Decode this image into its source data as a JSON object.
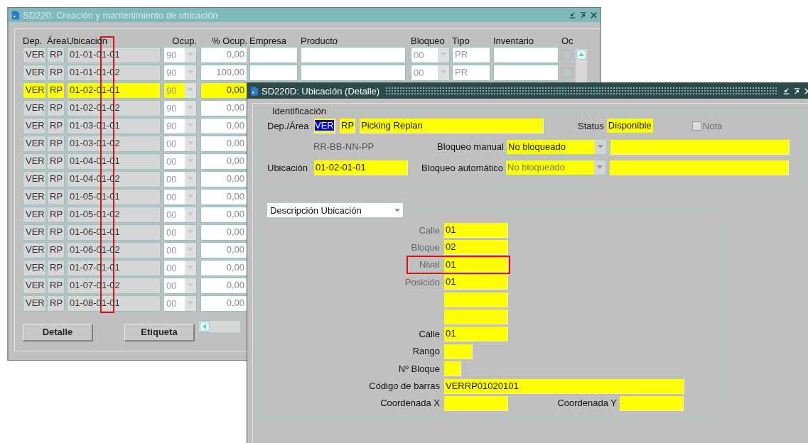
{
  "main_window": {
    "title": "SD220: Creación y mantenimiento de ubicación",
    "active": false,
    "columns": [
      "Dep.",
      "Área",
      "Ubicación",
      "Ocup.",
      "% Ocup.",
      "Empresa",
      "Producto",
      "Bloqueo",
      "Tipo",
      "Inventario",
      "Oc"
    ],
    "annotations": [
      {
        "kind": "column_frame"
      }
    ],
    "rows": [
      {
        "dep": "VER",
        "area": "RP",
        "ubicacion": "01-01-01-01",
        "ocup": "90",
        "pct_ocup": "0,00",
        "selected": false,
        "bloqueo": "00",
        "tipo": "PR",
        "oc_checked": false
      },
      {
        "dep": "VER",
        "area": "RP",
        "ubicacion": "01-01-01-02",
        "ocup": "90",
        "pct_ocup": "100,00",
        "selected": false,
        "bloqueo": "00",
        "tipo": "PR",
        "oc_checked": false
      },
      {
        "dep": "VER",
        "area": "RP",
        "ubicacion": "01-02-01-01",
        "ocup": "90",
        "pct_ocup": "0,00",
        "selected": true
      },
      {
        "dep": "VER",
        "area": "RP",
        "ubicacion": "01-02-01-02",
        "ocup": "90",
        "pct_ocup": "0,00",
        "selected": false
      },
      {
        "dep": "VER",
        "area": "RP",
        "ubicacion": "01-03-01-01",
        "ocup": "90",
        "pct_ocup": "0,00",
        "selected": false
      },
      {
        "dep": "VER",
        "area": "RP",
        "ubicacion": "01-03-01-02",
        "ocup": "00",
        "pct_ocup": "0,00",
        "selected": false
      },
      {
        "dep": "VER",
        "area": "RP",
        "ubicacion": "01-04-01-01",
        "ocup": "00",
        "pct_ocup": "0,00",
        "selected": false
      },
      {
        "dep": "VER",
        "area": "RP",
        "ubicacion": "01-04-01-02",
        "ocup": "00",
        "pct_ocup": "0,00",
        "selected": false
      },
      {
        "dep": "VER",
        "area": "RP",
        "ubicacion": "01-05-01-01",
        "ocup": "00",
        "pct_ocup": "0,00",
        "selected": false
      },
      {
        "dep": "VER",
        "area": "RP",
        "ubicacion": "01-05-01-02",
        "ocup": "00",
        "pct_ocup": "0,00",
        "selected": false
      },
      {
        "dep": "VER",
        "area": "RP",
        "ubicacion": "01-06-01-01",
        "ocup": "00",
        "pct_ocup": "0,00",
        "selected": false
      },
      {
        "dep": "VER",
        "area": "RP",
        "ubicacion": "01-06-01-02",
        "ocup": "00",
        "pct_ocup": "0,00",
        "selected": false
      },
      {
        "dep": "VER",
        "area": "RP",
        "ubicacion": "01-07-01-01",
        "ocup": "00",
        "pct_ocup": "0,00",
        "selected": false
      },
      {
        "dep": "VER",
        "area": "RP",
        "ubicacion": "01-07-01-02",
        "ocup": "00",
        "pct_ocup": "0,00",
        "selected": false
      },
      {
        "dep": "VER",
        "area": "RP",
        "ubicacion": "01-08-01-01",
        "ocup": "00",
        "pct_ocup": "0,00",
        "selected": false
      }
    ],
    "buttons": [
      "Detalle",
      "Etiqueta"
    ]
  },
  "detail_window": {
    "title": "SD220D: Ubicación (Detalle)",
    "active": true,
    "identificacion": {
      "legend": "Identificación",
      "dep_area_label": "Dep./Área",
      "dep": {
        "value": "VER",
        "text_selected": true
      },
      "area": "RP",
      "area_name": "Picking Replan",
      "status_label": "Status",
      "status": "Disponible",
      "nota": {
        "label": "Nota",
        "checked": false,
        "disabled": true
      },
      "format_hint": "RR-BB-NN-PP",
      "bloqueo_manual_label": "Bloqueo manual",
      "bloqueo_manual": {
        "value": "No bloqueado",
        "disabled": false
      },
      "ubicacion_label": "Ubicación",
      "ubicacion": "01-02-01-01",
      "bloqueo_automatico_label": "Bloqueo automático",
      "bloqueo_automatico": {
        "value": "No bloqueado",
        "disabled": true
      }
    },
    "descripcion": {
      "selector": "Descripción Ubicación",
      "fields": [
        {
          "kind": "field",
          "label": "Calle",
          "value": "01",
          "disabled": true,
          "highlighted": false
        },
        {
          "kind": "field",
          "label": "Bloque",
          "value": "02",
          "disabled": true,
          "highlighted": false
        },
        {
          "kind": "field",
          "label": "Nivel",
          "value": "01",
          "disabled": true,
          "highlighted": true
        },
        {
          "kind": "field",
          "label": "Posición",
          "value": "01",
          "disabled": true,
          "highlighted": false
        },
        {
          "kind": "field",
          "highlighted": false
        },
        {
          "kind": "field",
          "highlighted": false
        },
        {
          "kind": "field",
          "label": "Calle",
          "value": "01",
          "disabled": false,
          "highlighted": false
        },
        {
          "kind": "short",
          "label": "Rango",
          "disabled": false,
          "highlighted": false
        },
        {
          "kind": "tiny",
          "label": "Nº Bloque",
          "disabled": false,
          "highlighted": false
        },
        {
          "kind": "long",
          "label": "Código de barras",
          "value": "VERRP01020101",
          "disabled": false,
          "highlighted": false
        },
        {
          "kind": "pair",
          "label": "Coordenada X",
          "second_label": "Coordenada Y",
          "disabled": false,
          "highlighted": false
        }
      ]
    }
  }
}
